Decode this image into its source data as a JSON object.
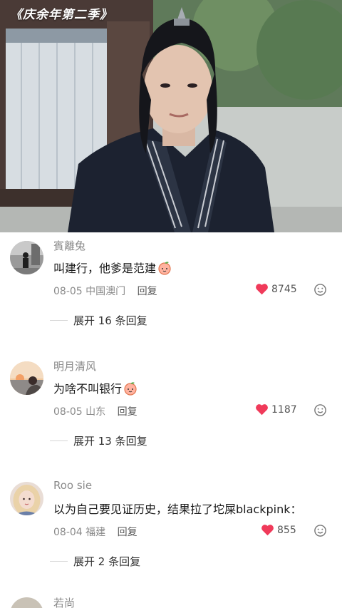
{
  "video": {
    "title": "《庆余年第二季》"
  },
  "comments": [
    {
      "username": "賓離兔",
      "text": "叫建行，他爹是范建",
      "has_peach_emoji": true,
      "date": "08-05",
      "location": "中国澳门",
      "reply_label": "回复",
      "likes": "8745",
      "expand_label": "展开 16 条回复",
      "avatar_icon": "person-silhouette-avatar"
    },
    {
      "username": "明月清风",
      "text": "为啥不叫银行",
      "has_peach_emoji": true,
      "date": "08-05",
      "location": "山东",
      "reply_label": "回复",
      "likes": "1187",
      "expand_label": "展开 13 条回复",
      "avatar_icon": "sunset-avatar"
    },
    {
      "username": "Roo sie",
      "text": "以为自己要见证历史，结果拉了坨屎blackpink：",
      "has_peach_emoji": false,
      "date": "08-04",
      "location": "福建",
      "reply_label": "回复",
      "likes": "855",
      "expand_label": "展开 2 条回复",
      "avatar_icon": "blonde-girl-avatar"
    }
  ],
  "next_comment_peek": {
    "username": "若尚"
  },
  "colors": {
    "heart": "#f03a5a",
    "meta_gray": "#8a8a8a",
    "text_dark": "#1a1a1a"
  }
}
